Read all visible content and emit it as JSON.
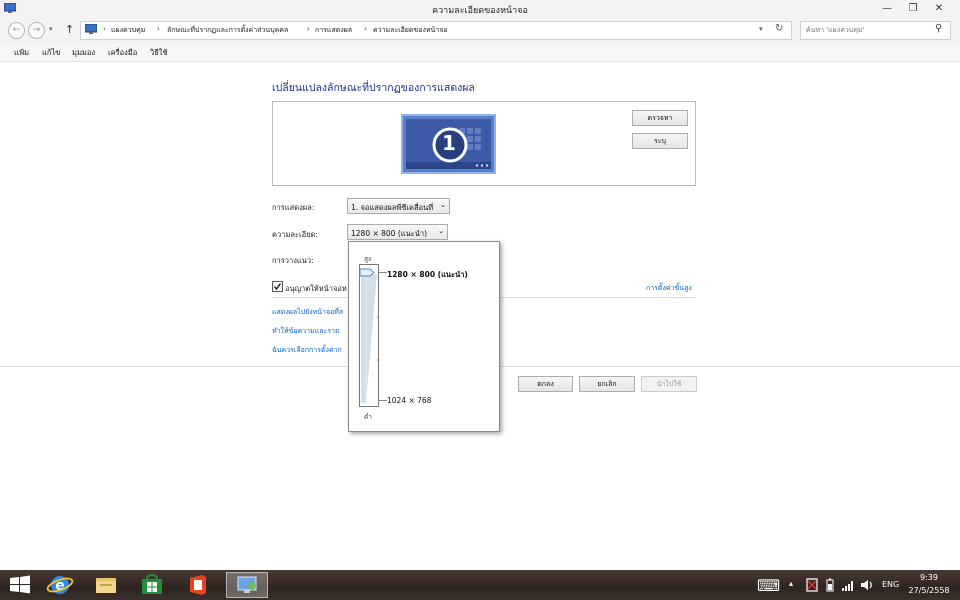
{
  "window": {
    "title": "ความละเอียดของหน้าจอ",
    "minimize": "—",
    "restore": "❐",
    "close": "✕"
  },
  "address": {
    "back": "←",
    "forward": "→",
    "up": "↑",
    "sep": "›",
    "crumbs": [
      "แผงควบคุม",
      "ลักษณะที่ปรากฏและการตั้งค่าส่วนบุคคล",
      "การแสดงผล",
      "ความละเอียดของหน้าจอ"
    ],
    "refresh": "↻",
    "search_placeholder": "ค้นหา 'แผงควบคุม'",
    "search_icon": "⚲"
  },
  "menu": [
    "แฟ้ม",
    "แก้ไข",
    "มุมมอง",
    "เครื่องมือ",
    "วิธีใช้"
  ],
  "main": {
    "heading": "เปลี่ยนแปลงลักษณะที่ปรากฏของการแสดงผล",
    "monitor_number": "1",
    "detect_button": "ตรวจหา",
    "identify_button": "ระบุ",
    "display_label": "การแสดงผล:",
    "display_value": "1. จอแสดงผลพีซีเคลื่อนที่",
    "resolution_label": "ความละเอียด:",
    "resolution_value": "1280 × 800 (แนะนำ)",
    "orientation_label": "การวางแนว:",
    "checkbox_label": "อนุญาตให้หน้าจอห",
    "checkbox_checked": true,
    "advanced_link": "การตั้งค่าขั้นสูง",
    "link1": "แสดงผลไปยังหน้าจอที่ส",
    "link2": "ทำให้ข้อความและราย",
    "link3": "ฉันควรเลือกการตั้งค่าก",
    "ok_button": "ตกลง",
    "cancel_button": "ยกเลิก",
    "apply_button": "นำไปใช้"
  },
  "popup": {
    "high_label": "สูง",
    "low_label": "ต่ำ",
    "top_value": "1280 × 800 (แนะนำ)",
    "bottom_value": "1024 × 768",
    "slider_level": 1.0
  },
  "taskbar": {
    "keyboard_icon": "⌨",
    "lang": "ENG",
    "time": "9:39",
    "date": "27/5/2558"
  },
  "colors": {
    "accent_blue": "#1e3287",
    "link_blue": "#0066cc",
    "monitor_blue": "#3d5aa8"
  }
}
